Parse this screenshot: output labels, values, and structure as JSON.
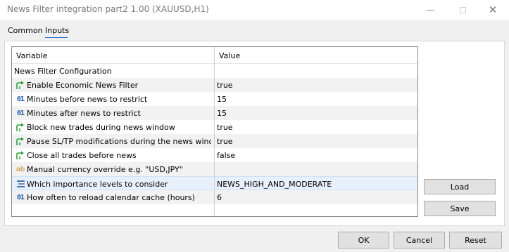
{
  "window": {
    "title": "News Filter integration part2 1.00 (XAUUSD,H1)"
  },
  "tabs": [
    {
      "label": "Common"
    },
    {
      "label": "Inputs"
    }
  ],
  "grid": {
    "columns": {
      "variable": "Variable",
      "value": "Value"
    },
    "rows": [
      {
        "type": "group",
        "name": "News Filter Configuration",
        "value": ""
      },
      {
        "type": "bool",
        "icon": "bool-arrow-icon",
        "name": "Enable Economic News Filter",
        "value": "true"
      },
      {
        "type": "int",
        "icon": "integer-icon",
        "name": "Minutes before news to restrict",
        "value": "15"
      },
      {
        "type": "int",
        "icon": "integer-icon",
        "name": "Minutes after news to restrict",
        "value": "15"
      },
      {
        "type": "bool",
        "icon": "bool-arrow-icon",
        "name": "Block new trades during news window",
        "value": "true"
      },
      {
        "type": "bool",
        "icon": "bool-arrow-icon",
        "name": "Pause SL/TP modifications during the news window [...",
        "value": "true"
      },
      {
        "type": "bool",
        "icon": "bool-arrow-icon",
        "name": "Close all trades before news",
        "value": "false"
      },
      {
        "type": "string",
        "icon": "string-icon",
        "name": "Manual currency override e.g. \"USD,JPY\"",
        "value": ""
      },
      {
        "type": "enum",
        "icon": "enum-list-icon",
        "name": "Which importance levels to consider",
        "value": "NEWS_HIGH_AND_MODERATE"
      },
      {
        "type": "int",
        "icon": "integer-icon",
        "name": "How often to reload calendar cache (hours)",
        "value": "6"
      }
    ]
  },
  "buttons": {
    "load": "Load",
    "save": "Save",
    "ok": "OK",
    "cancel": "Cancel",
    "reset": "Reset"
  },
  "icon_glyphs": {
    "integer": "01",
    "string": "ab"
  },
  "colors": {
    "accent": "#1a6fd1",
    "bool_icon": "#2e9e3a",
    "int_icon": "#1e5aa8",
    "string_icon": "#c98a1e",
    "selected_row": "#e8f1fb"
  }
}
